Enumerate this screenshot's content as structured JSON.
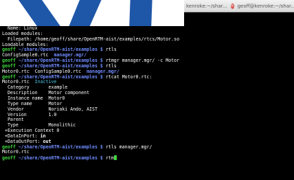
{
  "titlebar": {
    "tab1": "kenroke:~/shar...",
    "tab2": "geoff@kenroke:~/shar...",
    "close_symbol": "✕"
  },
  "terminal": {
    "prompt_user": "geoff",
    "prompt_path": "~/share/OpenRTM-aist/examples $",
    "lines": [
      {
        "type": "out",
        "text": "  Name: Linux"
      },
      {
        "type": "out",
        "text": "Loaded modules:"
      },
      {
        "type": "out",
        "text": "  Filepath: /home/geoff/share/OpenRTM-aist/examples/rtcs/Motor.so"
      },
      {
        "type": "out",
        "text": "Loadable modules:"
      },
      {
        "type": "cmd",
        "cmd": " rtls"
      },
      {
        "type": "mixed",
        "parts": [
          {
            "c": "w",
            "t": "ConfigSample0.rtc  "
          },
          {
            "c": "b",
            "t": "manager.mgr/"
          }
        ]
      },
      {
        "type": "cmd",
        "cmd": " rtmgr manager.mgr/ -c Motor"
      },
      {
        "type": "cmd",
        "cmd": " rtls"
      },
      {
        "type": "mixed",
        "parts": [
          {
            "c": "w",
            "t": "Motor0.rtc  ConfigSample0.rtc  "
          },
          {
            "c": "b",
            "t": "manager.mgr/"
          }
        ]
      },
      {
        "type": "cmd",
        "cmd": " rtcat Motor0.rtc:"
      },
      {
        "type": "mixed",
        "parts": [
          {
            "c": "w",
            "t": "Motor0.rtc  "
          },
          {
            "c": "cyan",
            "t": "Inactive"
          }
        ]
      },
      {
        "type": "out",
        "text": "  Category       example"
      },
      {
        "type": "out",
        "text": "  Description    Motor component"
      },
      {
        "type": "out",
        "text": "  Instance name  Motor0"
      },
      {
        "type": "out",
        "text": "  Type name      Motor"
      },
      {
        "type": "out",
        "text": "  Vendor         Noriaki Ando, AIST"
      },
      {
        "type": "out",
        "text": "  Version        1.0"
      },
      {
        "type": "out",
        "text": "  Parent"
      },
      {
        "type": "out",
        "text": "  Type           Monolithic"
      },
      {
        "type": "out",
        "text": " +Execution Context 0"
      },
      {
        "type": "bold",
        "parts": [
          {
            "c": "w",
            "t": " +DataInPort: "
          },
          {
            "c": "wb",
            "t": "in"
          }
        ]
      },
      {
        "type": "bold",
        "parts": [
          {
            "c": "w",
            "t": " +DataOutPort: "
          },
          {
            "c": "wb",
            "t": "out"
          }
        ]
      },
      {
        "type": "cmd",
        "cmd": " rtls manager.mgr/"
      },
      {
        "type": "out",
        "text": "Motor0.rtc"
      },
      {
        "type": "cmd_cursor",
        "cmd": " rtm"
      }
    ]
  }
}
